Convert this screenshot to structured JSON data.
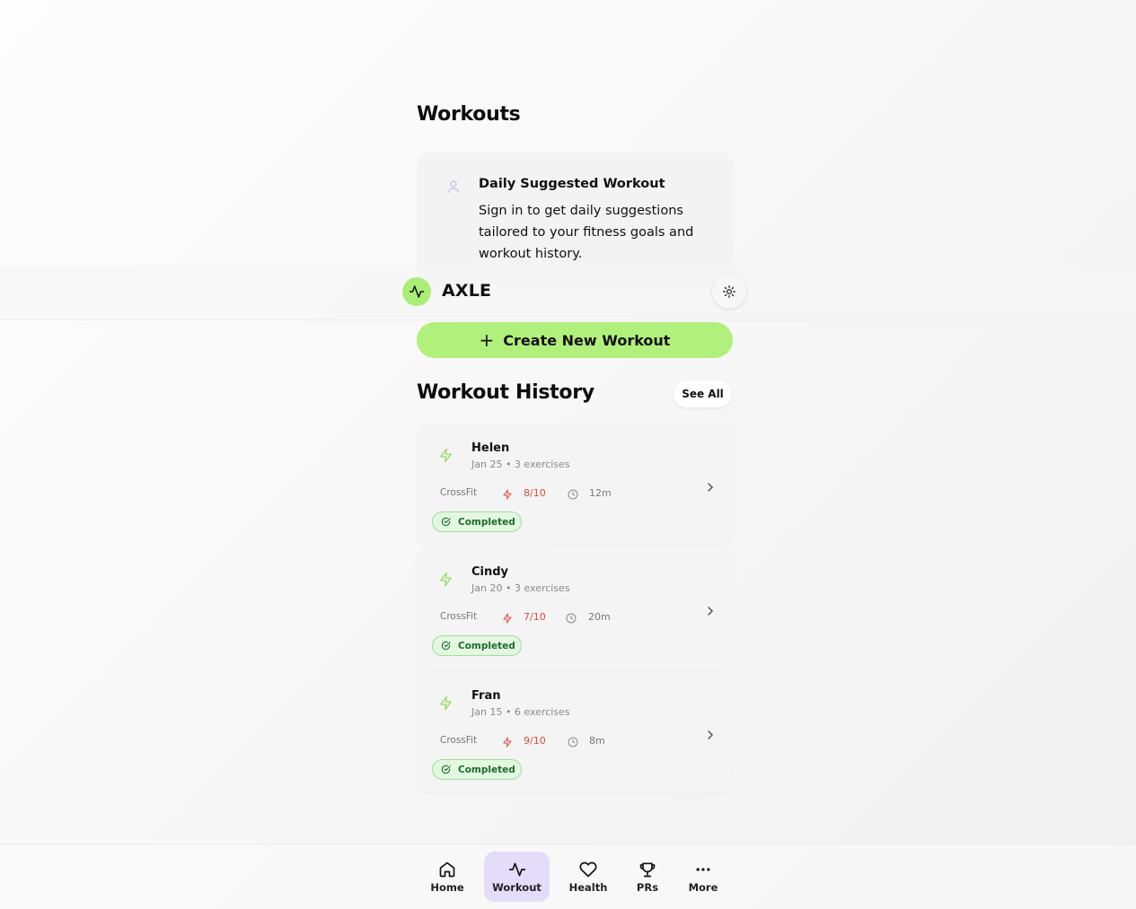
{
  "page": {
    "title": "Workouts"
  },
  "suggested": {
    "title": "Daily Suggested Workout",
    "text": "Sign in to get daily suggestions tailored to your fitness goals and workout history.",
    "icon": "user-icon"
  },
  "header": {
    "brand": "AXLE",
    "theme_icon": "sun-icon",
    "accent": "#aaee77"
  },
  "create_button": {
    "label": "Create New Workout",
    "icon": "plus-icon"
  },
  "history": {
    "title": "Workout History",
    "see_all": "See All",
    "items": [
      {
        "name": "Helen",
        "meta": "Jan 25 • 3 exercises",
        "type": "CrossFit",
        "intensity": "8/10",
        "duration": "12m",
        "status": "Completed"
      },
      {
        "name": "Cindy",
        "meta": "Jan 20 • 3 exercises",
        "type": "CrossFit",
        "intensity": "7/10",
        "duration": "20m",
        "status": "Completed"
      },
      {
        "name": "Fran",
        "meta": "Jan 15 • 6 exercises",
        "type": "CrossFit",
        "intensity": "9/10",
        "duration": "8m",
        "status": "Completed"
      }
    ]
  },
  "nav": {
    "items": [
      {
        "label": "Home",
        "icon": "home-icon"
      },
      {
        "label": "Workout",
        "icon": "activity-icon",
        "active": true
      },
      {
        "label": "Health",
        "icon": "heart-icon"
      },
      {
        "label": "PRs",
        "icon": "trophy-icon"
      },
      {
        "label": "More",
        "icon": "more-icon"
      }
    ]
  },
  "colors": {
    "accent_green": "#b2f07e",
    "intensity_red": "#e0483f",
    "nav_active": "#e3ddfa",
    "badge_green": "#e3f7e1"
  }
}
